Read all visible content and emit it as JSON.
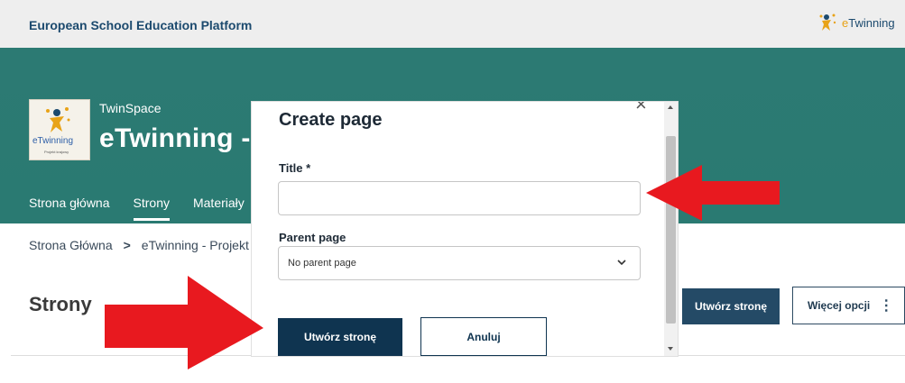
{
  "topbar": {
    "platform_title": "European School Education Platform",
    "logo_text_e": "e",
    "logo_text_rest": "Twinning"
  },
  "header": {
    "logo_text": "eTwinning",
    "logo_sub": "Projekt krajowy",
    "twinspace_label": "TwinSpace",
    "project_title": "eTwinning - P",
    "tabs": [
      {
        "label": "Strona główna",
        "active": false
      },
      {
        "label": "Strony",
        "active": true
      },
      {
        "label": "Materiały",
        "active": false
      }
    ]
  },
  "breadcrumb": {
    "home": "Strona Główna",
    "separator": ">",
    "current": "eTwinning - Projekt"
  },
  "main": {
    "heading": "Strony",
    "create_button": "Utwórz stronę",
    "more_button": "Więcej opcji",
    "more_icon": "⋮"
  },
  "modal": {
    "title": "Create page",
    "close_icon": "×",
    "title_label": "Title *",
    "title_value": "",
    "parent_label": "Parent page",
    "parent_value": "No parent page",
    "create_button": "Utwórz stronę",
    "cancel_button": "Anuluj"
  },
  "colors": {
    "header_green": "#2a7a72",
    "primary_navy": "#0f3450",
    "arrow_red": "#e8191f"
  }
}
